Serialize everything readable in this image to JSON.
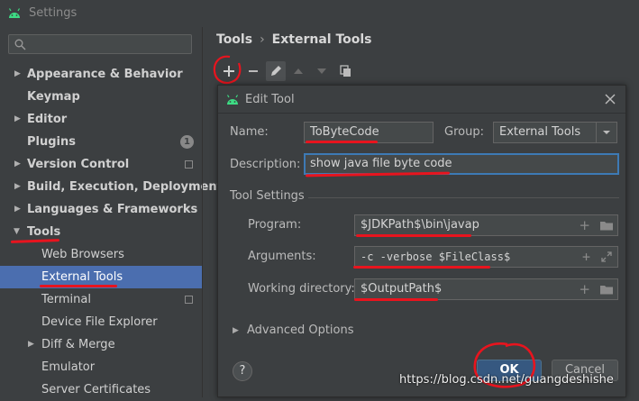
{
  "window": {
    "title": "Settings"
  },
  "search": {
    "placeholder": ""
  },
  "sidebar": {
    "items": [
      {
        "label": "Appearance & Behavior",
        "badge": ""
      },
      {
        "label": "Keymap",
        "badge": ""
      },
      {
        "label": "Editor",
        "badge": ""
      },
      {
        "label": "Plugins",
        "badge": "1"
      },
      {
        "label": "Version Control",
        "badge": ""
      },
      {
        "label": "Build, Execution, Deployment",
        "badge": ""
      },
      {
        "label": "Languages & Frameworks",
        "badge": ""
      },
      {
        "label": "Tools",
        "badge": ""
      },
      {
        "label": "Web Browsers",
        "badge": ""
      },
      {
        "label": "External Tools",
        "badge": ""
      },
      {
        "label": "Terminal",
        "badge": ""
      },
      {
        "label": "Device File Explorer",
        "badge": ""
      },
      {
        "label": "Diff & Merge",
        "badge": ""
      },
      {
        "label": "Emulator",
        "badge": ""
      },
      {
        "label": "Server Certificates",
        "badge": ""
      }
    ]
  },
  "breadcrumb": {
    "root": "Tools",
    "current": "External Tools"
  },
  "dialog": {
    "title": "Edit Tool",
    "name_label": "Name:",
    "name_value": "ToByteCode",
    "group_label": "Group:",
    "group_value": "External Tools",
    "description_label": "Description:",
    "description_value": "show java file byte code",
    "section_title": "Tool Settings",
    "program_label": "Program:",
    "program_value": "$JDKPath$\\bin\\javap",
    "arguments_label": "Arguments:",
    "arguments_value": "-c -verbose $FileClass$",
    "workdir_label": "Working directory:",
    "workdir_value": "$OutputPath$",
    "advanced_label": "Advanced Options",
    "ok_label": "OK",
    "cancel_label": "Cancel",
    "help_label": "?"
  },
  "watermark": "https://blog.csdn.net/guangdeshishe",
  "colors": {
    "selection": "#4b6eaf",
    "accent_focus": "#3d7ab5",
    "annotation_red": "#e8141e",
    "android_green": "#3ddc84"
  }
}
